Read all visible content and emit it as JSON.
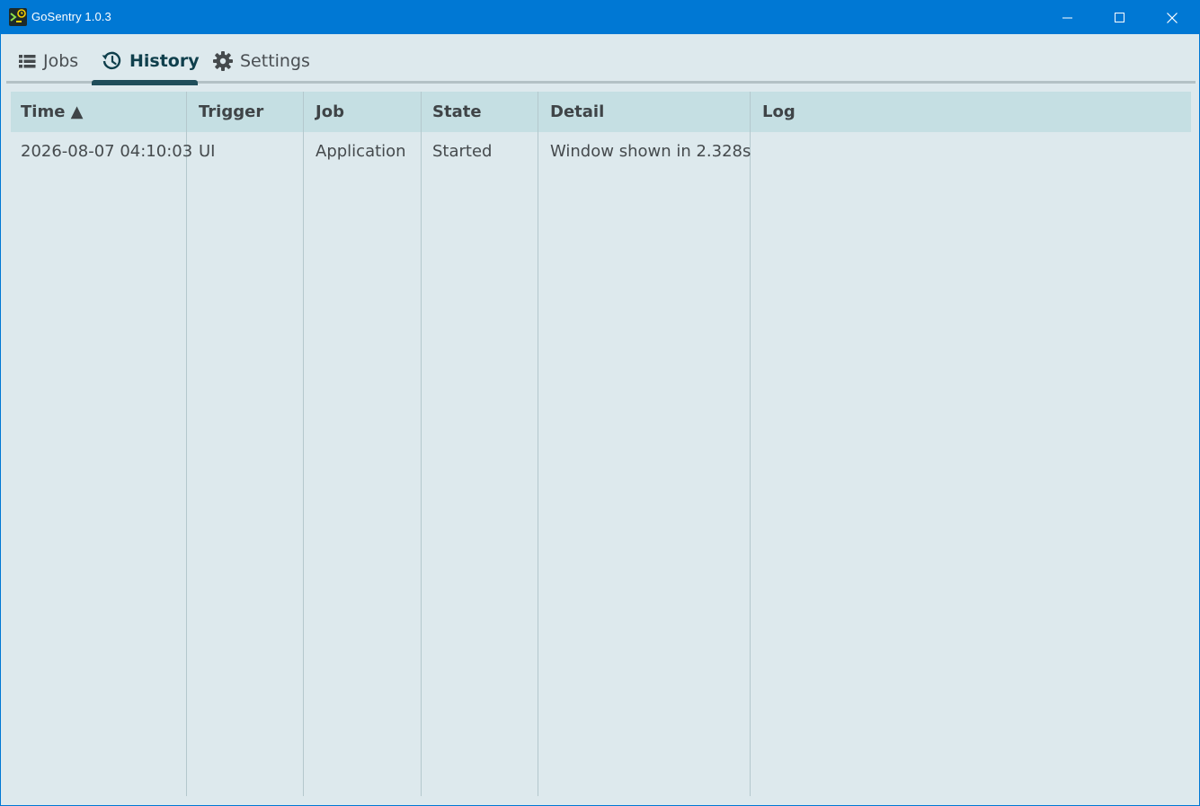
{
  "window": {
    "title": "GoSentry 1.0.3"
  },
  "tabs": [
    {
      "label": "Jobs",
      "icon": "list-icon",
      "active": false
    },
    {
      "label": "History",
      "icon": "history-icon",
      "active": true
    },
    {
      "label": "Settings",
      "icon": "gear-icon",
      "active": false
    }
  ],
  "table": {
    "headers": [
      "Time ▲",
      "Trigger",
      "Job",
      "State",
      "Detail",
      "Log"
    ],
    "rows": [
      [
        "2026-08-07 04:10:03",
        "UI",
        "Application",
        "Started",
        "Window shown in 2.328s",
        ""
      ]
    ]
  },
  "colors": {
    "titlebar": "#0078d4",
    "background": "#dde9ed",
    "header": "#c5dfe3",
    "accent": "#1f4d5a"
  }
}
